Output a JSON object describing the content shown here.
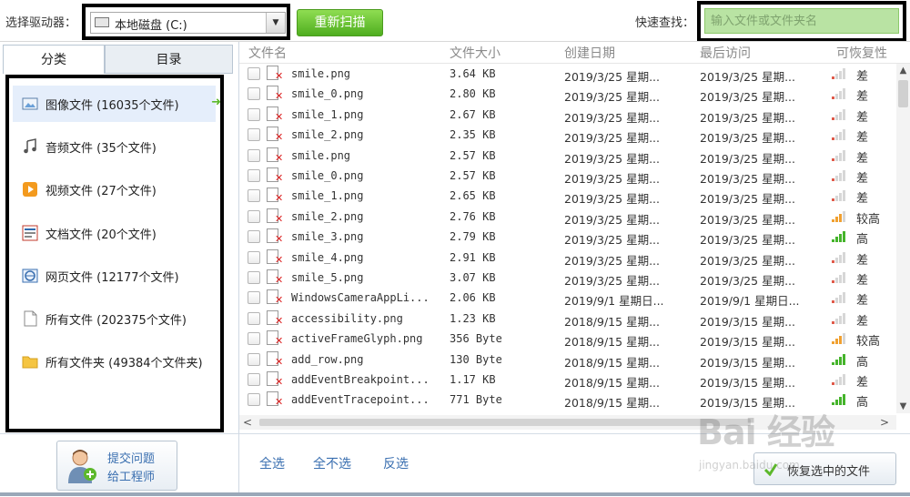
{
  "toolbar": {
    "drive_label": "选择驱动器：",
    "drive_value": "本地磁盘 (C:)",
    "rescan_label": "重新扫描",
    "quick_search_label": "快速查找：",
    "search_placeholder": "输入文件或文件夹名"
  },
  "sidebar": {
    "tabs": [
      {
        "label": "分类",
        "active": true
      },
      {
        "label": "目录",
        "active": false
      }
    ],
    "categories": [
      {
        "label": "图像文件 (16035个文件)",
        "icon": "image-icon",
        "selected": true
      },
      {
        "label": "音频文件 (35个文件)",
        "icon": "music-note-icon",
        "selected": false
      },
      {
        "label": "视频文件 (27个文件)",
        "icon": "video-icon",
        "selected": false
      },
      {
        "label": "文档文件 (20个文件)",
        "icon": "document-icon",
        "selected": false
      },
      {
        "label": "网页文件 (12177个文件)",
        "icon": "webpage-icon",
        "selected": false
      },
      {
        "label": "所有文件 (202375个文件)",
        "icon": "file-icon",
        "selected": false
      },
      {
        "label": "所有文件夹 (49384个文件夹)",
        "icon": "folder-icon",
        "selected": false
      }
    ],
    "support_line1": "提交问题",
    "support_line2": "给工程师"
  },
  "table": {
    "columns": [
      "文件名",
      "文件大小",
      "创建日期",
      "最后访问",
      "可恢复性"
    ],
    "rows": [
      {
        "name": "smile.png",
        "size": "3.64 KB",
        "created": "2019/3/25 星期...",
        "accessed": "2019/3/25 星期...",
        "recover": "差",
        "level": 1
      },
      {
        "name": "smile_0.png",
        "size": "2.80 KB",
        "created": "2019/3/25 星期...",
        "accessed": "2019/3/25 星期...",
        "recover": "差",
        "level": 1
      },
      {
        "name": "smile_1.png",
        "size": "2.67 KB",
        "created": "2019/3/25 星期...",
        "accessed": "2019/3/25 星期...",
        "recover": "差",
        "level": 1
      },
      {
        "name": "smile_2.png",
        "size": "2.35 KB",
        "created": "2019/3/25 星期...",
        "accessed": "2019/3/25 星期...",
        "recover": "差",
        "level": 1
      },
      {
        "name": "smile.png",
        "size": "2.57 KB",
        "created": "2019/3/25 星期...",
        "accessed": "2019/3/25 星期...",
        "recover": "差",
        "level": 1
      },
      {
        "name": "smile_0.png",
        "size": "2.57 KB",
        "created": "2019/3/25 星期...",
        "accessed": "2019/3/25 星期...",
        "recover": "差",
        "level": 1
      },
      {
        "name": "smile_1.png",
        "size": "2.65 KB",
        "created": "2019/3/25 星期...",
        "accessed": "2019/3/25 星期...",
        "recover": "差",
        "level": 1
      },
      {
        "name": "smile_2.png",
        "size": "2.76 KB",
        "created": "2019/3/25 星期...",
        "accessed": "2019/3/25 星期...",
        "recover": "较高",
        "level": 3
      },
      {
        "name": "smile_3.png",
        "size": "2.79 KB",
        "created": "2019/3/25 星期...",
        "accessed": "2019/3/25 星期...",
        "recover": "高",
        "level": 4
      },
      {
        "name": "smile_4.png",
        "size": "2.91 KB",
        "created": "2019/3/25 星期...",
        "accessed": "2019/3/25 星期...",
        "recover": "差",
        "level": 1
      },
      {
        "name": "smile_5.png",
        "size": "3.07 KB",
        "created": "2019/3/25 星期...",
        "accessed": "2019/3/25 星期...",
        "recover": "差",
        "level": 1
      },
      {
        "name": "WindowsCameraAppLi...",
        "size": "2.06 KB",
        "created": "2019/9/1 星期日...",
        "accessed": "2019/9/1 星期日...",
        "recover": "差",
        "level": 1
      },
      {
        "name": "accessibility.png",
        "size": "1.23 KB",
        "created": "2018/9/15 星期...",
        "accessed": "2019/3/15 星期...",
        "recover": "差",
        "level": 1
      },
      {
        "name": "activeFrameGlyph.png",
        "size": "356 Byte",
        "created": "2018/9/15 星期...",
        "accessed": "2019/3/15 星期...",
        "recover": "较高",
        "level": 3
      },
      {
        "name": "add_row.png",
        "size": "130 Byte",
        "created": "2018/9/15 星期...",
        "accessed": "2019/3/15 星期...",
        "recover": "高",
        "level": 4
      },
      {
        "name": "addEventBreakpoint...",
        "size": "1.17 KB",
        "created": "2018/9/15 星期...",
        "accessed": "2019/3/15 星期...",
        "recover": "差",
        "level": 1
      },
      {
        "name": "addEventTracepoint...",
        "size": "771 Byte",
        "created": "2018/9/15 星期...",
        "accessed": "2019/3/15 星期...",
        "recover": "高",
        "level": 4
      }
    ]
  },
  "actions": {
    "select_all": "全选",
    "select_none": "全不选",
    "invert": "反选",
    "recover_label": "恢复选中的文件"
  },
  "watermark": {
    "main": "Bai 经验",
    "sub": "jingyan.baidu.com"
  },
  "colors": {
    "accent_green": "#5cb82b",
    "signal_orange": "#f0a030",
    "signal_red": "#e05a4a",
    "signal_green": "#45b42b",
    "link_blue": "#3a6fb0"
  }
}
